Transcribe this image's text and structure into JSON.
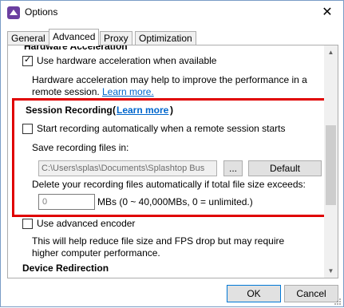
{
  "window": {
    "title": "Options",
    "title_partial": "Options"
  },
  "icons": {
    "app": "splashtop-app-icon",
    "close": "close-icon"
  },
  "tabs": [
    {
      "label": "General",
      "active": false
    },
    {
      "label": "Advanced",
      "active": true
    },
    {
      "label": "Proxy",
      "active": false
    },
    {
      "label": "Optimization",
      "active": false
    }
  ],
  "hardware": {
    "heading_cut": "Hardware Acceleration",
    "checkbox_label": "Use hardware acceleration when available",
    "checked": true,
    "desc_line1": "Hardware acceleration may help to improve the performance in a",
    "desc_line2": "remote session.",
    "learn_more": "Learn more."
  },
  "session_recording": {
    "heading": "Session Recording",
    "heading_open": "(",
    "learn_more": "Learn more",
    "heading_close": ")",
    "auto_record_label": "Start recording automatically when a remote session starts",
    "auto_record_checked": false,
    "save_label": "Save recording files in:",
    "save_path": "C:\\Users\\splas\\Documents\\Splashtop Bus",
    "browse_label": "...",
    "default_label": "Default",
    "delete_label": "Delete your recording files automatically if total file size exceeds:",
    "size_value": "0",
    "size_hint": "MBs (0 ~ 40,000MBs, 0 = unlimited.)"
  },
  "advanced_encoder": {
    "checkbox_label": "Use advanced encoder",
    "checked": false,
    "desc_line1": "This will help reduce file size and FPS drop but may require",
    "desc_line2": "higher computer performance."
  },
  "device_redirection": {
    "heading": "Device Redirection"
  },
  "footer": {
    "ok_label": "OK",
    "cancel_label": "Cancel"
  },
  "colors": {
    "highlight_box": "#e00000",
    "link": "#0066cc",
    "ok_border": "#0078d7"
  }
}
